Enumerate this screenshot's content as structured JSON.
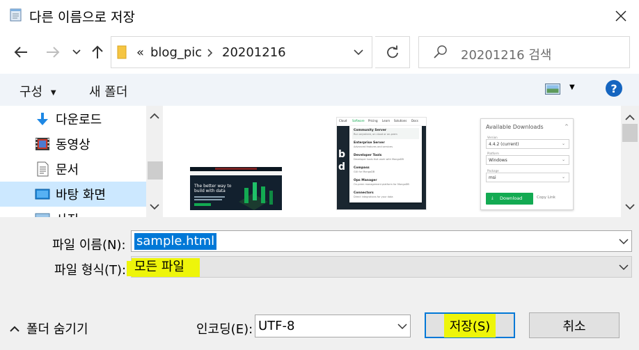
{
  "window": {
    "title": "다른 이름으로 저장",
    "close_icon": "close-icon"
  },
  "nav": {
    "back_icon": "arrow-left-icon",
    "forward_icon": "arrow-right-icon",
    "recent_icon": "chevron-down-icon",
    "up_icon": "arrow-up-icon"
  },
  "address": {
    "overflow": "«",
    "crumbs": [
      "blog_pic",
      "20201216"
    ],
    "refresh_icon": "refresh-icon"
  },
  "search": {
    "placeholder": "20201216 검색"
  },
  "toolbar": {
    "organize_label": "구성",
    "new_folder_label": "새 폴더",
    "help_label": "?"
  },
  "sidebar": {
    "items": [
      {
        "label": "다운로드",
        "icon": "download-icon"
      },
      {
        "label": "동영상",
        "icon": "video-icon"
      },
      {
        "label": "문서",
        "icon": "document-icon"
      },
      {
        "label": "바탕 화면",
        "icon": "desktop-icon",
        "selected": true
      },
      {
        "label": "사진",
        "icon": "picture-icon"
      }
    ]
  },
  "thumbnails": [
    {
      "name": "thumb-mongodb-home",
      "headline1": "The better way to",
      "headline2": "build with data"
    },
    {
      "name": "thumb-mongodb-menu",
      "tabs": [
        "Cloud",
        "Software",
        "Pricing",
        "Learn",
        "Solutions",
        "Docs"
      ],
      "menu": [
        {
          "title": "Community Server",
          "desc": "Run anywhere, on cloud or on-prem"
        },
        {
          "title": "Enterprise Server",
          "desc": "Advanced features and services"
        },
        {
          "title": "Developer Tools",
          "desc": "Developer tools that work with MongoDB"
        },
        {
          "title": "Compass",
          "desc": "GUI for MongoDB"
        },
        {
          "title": "Ops Manager",
          "desc": "On-prem management platform for MongoDB"
        },
        {
          "title": "Connectors",
          "desc": "Direct integrations for your data"
        }
      ]
    },
    {
      "name": "thumb-available-downloads",
      "heading": "Available Downloads",
      "version_label": "Version",
      "version_value": "4.4.2 (current)",
      "platform_label": "Platform",
      "platform_value": "Windows",
      "package_label": "Package",
      "package_value": "msi",
      "download_label": "Download",
      "copy_link_label": "Copy Link"
    }
  ],
  "form": {
    "filename_label": "파일 이름(N):",
    "filename_value": "sample.html",
    "filetype_label": "파일 형식(T):",
    "filetype_value": "모든 파일",
    "hide_folders_label": "폴더 숨기기",
    "encoding_label": "인코딩(E):",
    "encoding_value": "UTF-8",
    "save_label": "저장(S)",
    "cancel_label": "취소"
  },
  "colors": {
    "accent": "#0078d7",
    "highlight": "#eef50a",
    "help_blue": "#1565c0"
  }
}
